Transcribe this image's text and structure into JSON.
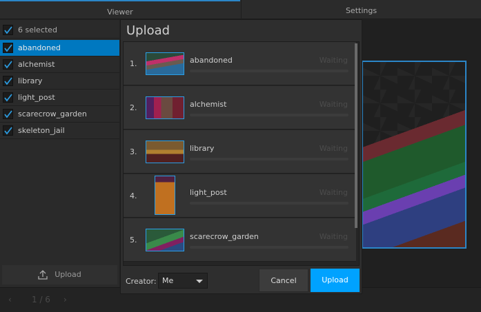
{
  "tabs": {
    "viewer": "Viewer",
    "settings": "Settings"
  },
  "sidebar": {
    "header": "6 selected",
    "items": [
      {
        "label": "abandoned",
        "selected": true
      },
      {
        "label": "alchemist"
      },
      {
        "label": "library"
      },
      {
        "label": "light_post"
      },
      {
        "label": "scarecrow_garden"
      },
      {
        "label": "skeleton_jail"
      }
    ],
    "upload_label": "Upload"
  },
  "pagination": {
    "prev": "‹",
    "page": "1 / 6",
    "next": "›"
  },
  "modal": {
    "title": "Upload",
    "items": [
      {
        "num": "1.",
        "name": "abandoned",
        "status": "Waiting",
        "progress": 0
      },
      {
        "num": "2.",
        "name": "alchemist",
        "status": "Waiting",
        "progress": 0
      },
      {
        "num": "3.",
        "name": "library",
        "status": "Waiting",
        "progress": 0
      },
      {
        "num": "4.",
        "name": "light_post",
        "status": "Waiting",
        "progress": 0
      },
      {
        "num": "5.",
        "name": "scarecrow_garden",
        "status": "Waiting",
        "progress": 0
      }
    ],
    "creator_label": "Creator:",
    "creator_value": "Me",
    "cancel": "Cancel",
    "upload": "Upload"
  },
  "colors": {
    "accent": "#00a2ff",
    "selection": "#0078c0",
    "frame": "#2b86c8"
  }
}
